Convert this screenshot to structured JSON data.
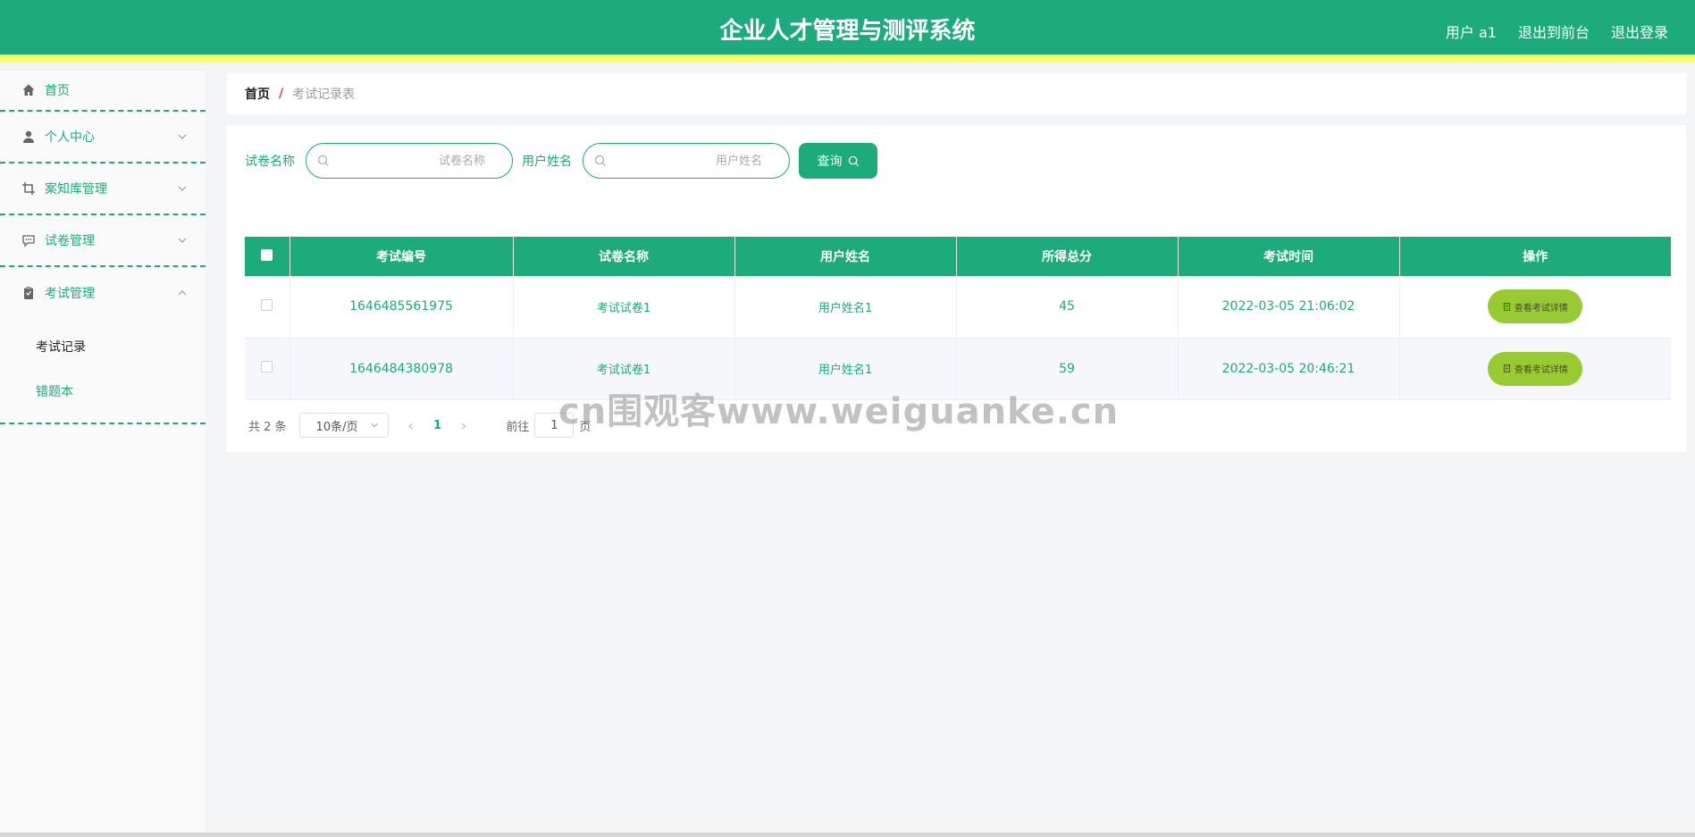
{
  "header": {
    "title": "企业人才管理与测评系统",
    "user_label": "用户 a1",
    "exit_front_label": "退出到前台",
    "logout_label": "退出登录"
  },
  "sidebar": {
    "items": [
      {
        "label": "首页",
        "icon": "home-icon"
      },
      {
        "label": "个人中心",
        "icon": "user-icon"
      },
      {
        "label": "案知库管理",
        "icon": "crop-icon"
      },
      {
        "label": "试卷管理",
        "icon": "chat-icon"
      },
      {
        "label": "考试管理",
        "icon": "clipboard-icon"
      }
    ],
    "submenu": [
      {
        "label": "考试记录"
      },
      {
        "label": "错题本"
      }
    ]
  },
  "breadcrumb": {
    "home": "首页",
    "separator": "/",
    "current": "考试记录表"
  },
  "search": {
    "paper_label": "试卷名称",
    "paper_placeholder": "试卷名称",
    "user_label": "用户姓名",
    "user_placeholder": "用户姓名",
    "query_label": "查询"
  },
  "table": {
    "headers": [
      "考试编号",
      "试卷名称",
      "用户姓名",
      "所得总分",
      "考试时间",
      "操作"
    ],
    "rows": [
      {
        "id": "1646485561975",
        "paper": "考试试卷1",
        "user": "用户姓名1",
        "score": "45",
        "time": "2022-03-05 21:06:02",
        "action": "查看考试详情"
      },
      {
        "id": "1646484380978",
        "paper": "考试试卷1",
        "user": "用户姓名1",
        "score": "59",
        "time": "2022-03-05 20:46:21",
        "action": "查看考试详情"
      }
    ]
  },
  "pager": {
    "total_label": "共 2 条",
    "page_size": "10条/页",
    "prev": "‹",
    "current_page": "1",
    "next": "›",
    "goto_label": "前往",
    "goto_value": "1",
    "page_suffix": "页"
  },
  "watermark": "cn围观客www.weiguanke.cn",
  "colors": {
    "primary": "#1dab7b",
    "header_stripe": "#f8ff5e",
    "action_button": "#98cb33",
    "breadcrumb_separator": "#e2482b"
  }
}
